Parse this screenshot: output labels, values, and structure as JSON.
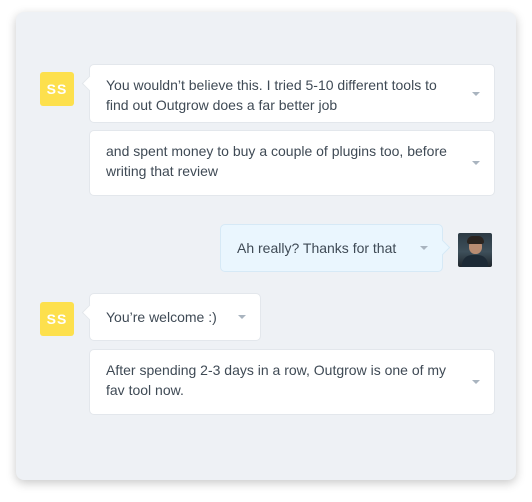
{
  "conversation": {
    "other_avatar_initials": "SS",
    "messages": [
      {
        "id": "m1",
        "sender": "other",
        "text": "You wouldn’t believe this. I tried 5-10 different tools to find out Outgrow does a far better job"
      },
      {
        "id": "m2",
        "sender": "other",
        "text": "and spent money to buy a couple of plugins too, before writing that review"
      },
      {
        "id": "m3",
        "sender": "self",
        "text": "Ah really? Thanks for that"
      },
      {
        "id": "m4",
        "sender": "other",
        "text": "You’re welcome :)"
      },
      {
        "id": "m5",
        "sender": "other",
        "text": "After spending 2-3 days in a row, Outgrow is one of my fav tool now."
      }
    ]
  },
  "colors": {
    "avatar_bg": "#fde04d",
    "panel_bg": "#eef1f5",
    "self_bubble_bg": "#eaf6fe",
    "other_bubble_bg": "#ffffff"
  },
  "icons": {
    "message_menu": "chevron-down-icon",
    "self_avatar": "user-photo"
  }
}
